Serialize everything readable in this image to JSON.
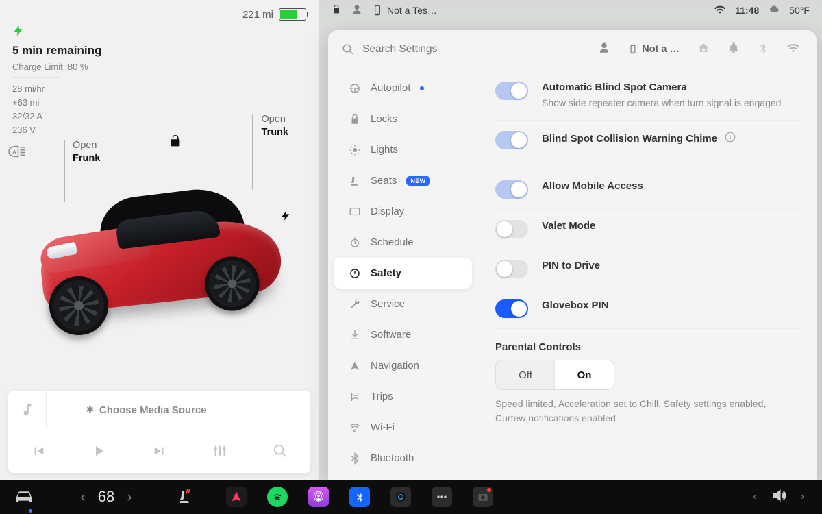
{
  "status": {
    "range": "221 mi",
    "device": "Not a Tes…",
    "time": "11:48",
    "temp": "50°F"
  },
  "charge": {
    "remaining": "5 min remaining",
    "limit": "Charge Limit: 80 %",
    "rate": "28 mi/hr",
    "added": "+63 mi",
    "amps": "32/32 A",
    "volts": "236 V"
  },
  "car": {
    "frunk_label": "Open",
    "frunk_bold": "Frunk",
    "trunk_label": "Open",
    "trunk_bold": "Trunk"
  },
  "media": {
    "source": "Choose Media Source"
  },
  "settings": {
    "search_placeholder": "Search Settings",
    "device_short": "Not a …",
    "nav": {
      "autopilot": "Autopilot",
      "locks": "Locks",
      "lights": "Lights",
      "seats": "Seats",
      "seats_new": "NEW",
      "display": "Display",
      "schedule": "Schedule",
      "safety": "Safety",
      "service": "Service",
      "software": "Software",
      "navigation": "Navigation",
      "trips": "Trips",
      "wifi": "Wi-Fi",
      "bluetooth": "Bluetooth"
    },
    "items": {
      "blindspot_cam": {
        "title": "Automatic Blind Spot Camera",
        "sub": "Show side repeater camera when turn signal is engaged"
      },
      "blindspot_chime": {
        "title": "Blind Spot Collision Warning Chime"
      },
      "mobile": {
        "title": "Allow Mobile Access"
      },
      "valet": {
        "title": "Valet Mode"
      },
      "pin_drive": {
        "title": "PIN to Drive"
      },
      "glovebox": {
        "title": "Glovebox PIN"
      }
    },
    "parental": {
      "heading": "Parental Controls",
      "off": "Off",
      "on": "On",
      "desc": "Speed limited, Acceleration set to Chill, Safety settings enabled, Curfew notifications enabled"
    }
  },
  "dock": {
    "temp": "68"
  }
}
